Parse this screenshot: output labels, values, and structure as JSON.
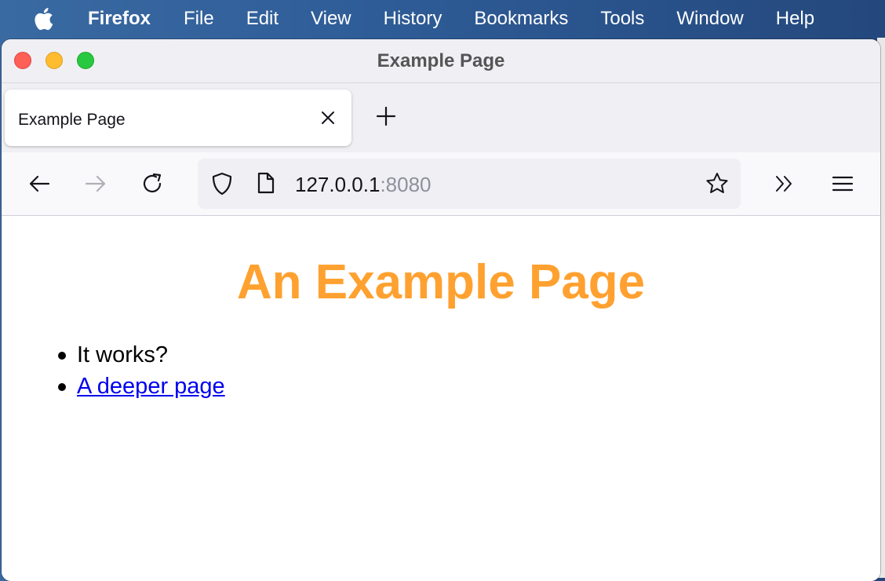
{
  "menubar": {
    "app_name": "Firefox",
    "items": [
      "File",
      "Edit",
      "View",
      "History",
      "Bookmarks",
      "Tools",
      "Window",
      "Help"
    ]
  },
  "window": {
    "title": "Example Page"
  },
  "tabs": [
    {
      "label": "Example Page",
      "active": true
    }
  ],
  "url": {
    "host": "127.0.0.1",
    "port": ":8080"
  },
  "page": {
    "heading": "An Example Page",
    "heading_color": "#ffa130",
    "list": [
      {
        "text": "It works?"
      },
      {
        "text": "A deeper page",
        "link": true
      }
    ]
  },
  "icons": {
    "back": "back-arrow-icon",
    "forward": "forward-arrow-icon",
    "reload": "reload-icon",
    "shield": "tracking-protection-shield-icon",
    "page": "page-icon",
    "star": "bookmark-star-icon",
    "overflow": "overflow-chevrons-icon",
    "menu": "hamburger-menu-icon"
  }
}
